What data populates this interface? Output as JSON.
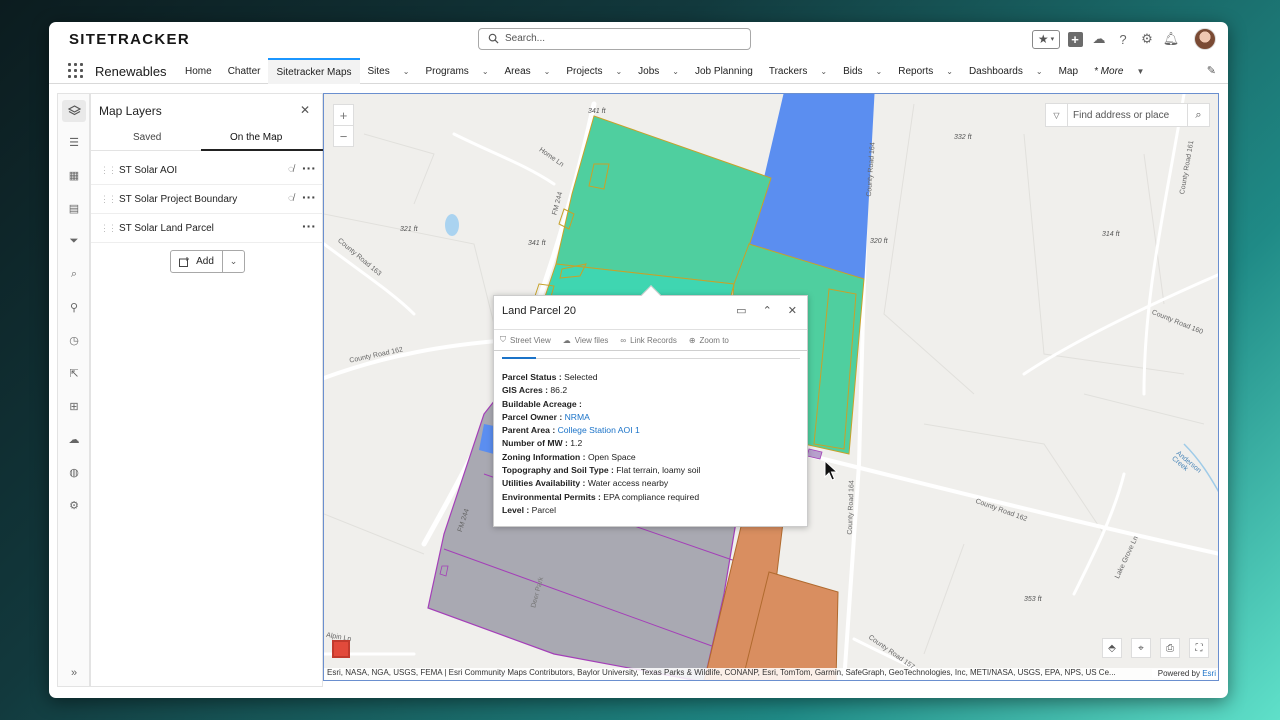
{
  "header": {
    "logo": "SITETRACKER",
    "search_placeholder": "Search..."
  },
  "nav": {
    "app_name": "Renewables",
    "items": [
      {
        "label": "Home",
        "has_menu": false
      },
      {
        "label": "Chatter",
        "has_menu": false
      },
      {
        "label": "Sitetracker Maps",
        "has_menu": false,
        "active": true
      },
      {
        "label": "Sites",
        "has_menu": true
      },
      {
        "label": "Programs",
        "has_menu": true
      },
      {
        "label": "Areas",
        "has_menu": true
      },
      {
        "label": "Projects",
        "has_menu": true
      },
      {
        "label": "Jobs",
        "has_menu": true
      },
      {
        "label": "Job Planning",
        "has_menu": false
      },
      {
        "label": "Trackers",
        "has_menu": true
      },
      {
        "label": "Bids",
        "has_menu": true
      },
      {
        "label": "Reports",
        "has_menu": true
      },
      {
        "label": "Dashboards",
        "has_menu": true
      },
      {
        "label": "Map",
        "has_menu": false
      },
      {
        "label": "* More",
        "has_menu": true
      }
    ]
  },
  "panel": {
    "title": "Map Layers",
    "tabs": [
      "Saved",
      "On the Map"
    ],
    "active_tab": "On the Map",
    "layers": [
      {
        "name": "ST Solar AOI",
        "hidden_icon": true
      },
      {
        "name": "ST Solar Project Boundary",
        "hidden_icon": true
      },
      {
        "name": "ST Solar Land Parcel",
        "hidden_icon": false
      }
    ],
    "add_label": "Add"
  },
  "map": {
    "find_placeholder": "Find address or place",
    "labels": {
      "road_home_ln": "Home Ln",
      "road_fm244": "FM 244",
      "road_fm244b": "FM 244",
      "road_cr164": "County Road 164",
      "road_cr164b": "County Road 164",
      "road_cr162": "County Road 162",
      "road_cr162b": "County Road 162",
      "road_cr163": "County Road 163",
      "road_cr161": "County Road 161",
      "road_cr160": "County Road 160",
      "road_cr157": "County Road 157",
      "road_anderson": "Anderson Creek",
      "road_lakegrove": "Lake Grove Ln",
      "road_alpin": "Alpin Ln",
      "road_deerpark": "Deer Park",
      "el_341a": "341 ft",
      "el_341b": "341 ft",
      "el_321": "321 ft",
      "el_320": "320 ft",
      "el_332": "332 ft",
      "el_314": "314 ft",
      "el_353": "353 ft"
    },
    "attribution": "Esri, NASA, NGA, USGS, FEMA | Esri Community Maps Contributors, Baylor University, Texas Parks & Wildlife, CONANP, Esri, TomTom, Garmin, SafeGraph, GeoTechnologies, Inc, METI/NASA, USGS, EPA, NPS, US Ce...",
    "powered_by": "Powered by",
    "powered_link": "Esri"
  },
  "popup": {
    "title": "Land Parcel 20",
    "tools": [
      "Street View",
      "View files",
      "Link Records",
      "Zoom to"
    ],
    "fields": [
      {
        "label": "Parcel Status",
        "value": "Selected",
        "link": false
      },
      {
        "label": "GIS Acres",
        "value": "86.2",
        "link": false
      },
      {
        "label": "Buildable Acreage",
        "value": "",
        "link": false
      },
      {
        "label": "Parcel Owner",
        "value": "NRMA",
        "link": true
      },
      {
        "label": "Parent Area",
        "value": "College Station AOI 1",
        "link": true
      },
      {
        "label": "Number of MW",
        "value": "1.2",
        "link": false
      },
      {
        "label": "Zoning Information",
        "value": "Open Space",
        "link": false
      },
      {
        "label": "Topography and Soil Type",
        "value": "Flat terrain, loamy soil",
        "link": false
      },
      {
        "label": "Utilities Availability",
        "value": "Water access nearby",
        "link": false
      },
      {
        "label": "Environmental Permits",
        "value": "EPA compliance required",
        "link": false
      },
      {
        "label": "Level",
        "value": "Parcel",
        "link": false
      }
    ]
  },
  "colors": {
    "accent": "#1b96ff",
    "parcel_green": "#4fcf9f",
    "parcel_blue": "#5b8ef0",
    "parcel_gray": "#a9a9b2",
    "parcel_orange": "#d98e60",
    "link": "#1b73c8"
  }
}
